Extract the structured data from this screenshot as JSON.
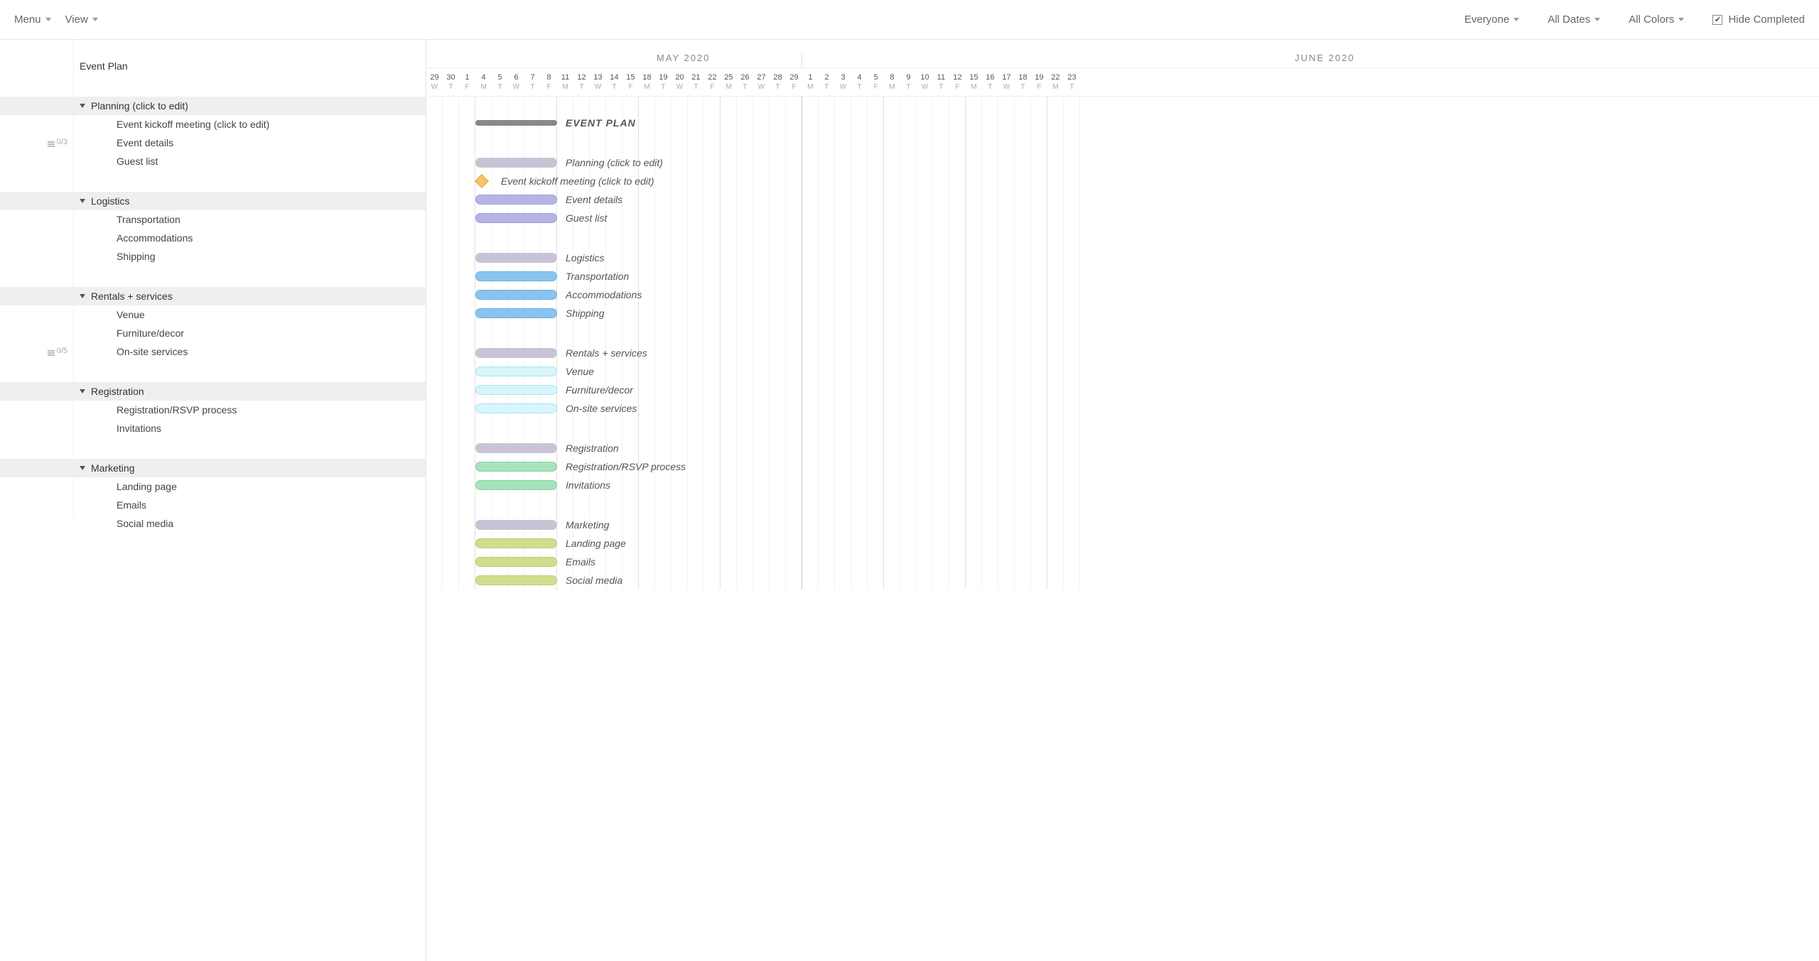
{
  "toolbar": {
    "menu": "Menu",
    "view": "View",
    "filters": {
      "everyone": "Everyone",
      "all_dates": "All Dates",
      "all_colors": "All Colors",
      "hide_completed": "Hide Completed"
    }
  },
  "timeline": {
    "months": [
      {
        "label": "MAY 2020",
        "days": 31,
        "start_index": 2
      },
      {
        "label": "JUNE 2020",
        "days": 30,
        "start_index": 33
      }
    ],
    "first_visible": {
      "day": 29,
      "letter": "W"
    },
    "days": [
      {
        "n": 29,
        "l": "W"
      },
      {
        "n": 30,
        "l": "T"
      },
      {
        "n": 1,
        "l": "F"
      },
      {
        "n": 4,
        "l": "M"
      },
      {
        "n": 5,
        "l": "T"
      },
      {
        "n": 6,
        "l": "W"
      },
      {
        "n": 7,
        "l": "T"
      },
      {
        "n": 8,
        "l": "F"
      },
      {
        "n": 11,
        "l": "M"
      },
      {
        "n": 12,
        "l": "T"
      },
      {
        "n": 13,
        "l": "W"
      },
      {
        "n": 14,
        "l": "T"
      },
      {
        "n": 15,
        "l": "F"
      },
      {
        "n": 18,
        "l": "M"
      },
      {
        "n": 19,
        "l": "T"
      },
      {
        "n": 20,
        "l": "W"
      },
      {
        "n": 21,
        "l": "T"
      },
      {
        "n": 22,
        "l": "F"
      },
      {
        "n": 25,
        "l": "M"
      },
      {
        "n": 26,
        "l": "T"
      },
      {
        "n": 27,
        "l": "W"
      },
      {
        "n": 28,
        "l": "T"
      },
      {
        "n": 29,
        "l": "F"
      },
      {
        "n": 1,
        "l": "M"
      },
      {
        "n": 2,
        "l": "T"
      },
      {
        "n": 3,
        "l": "W"
      },
      {
        "n": 4,
        "l": "T"
      },
      {
        "n": 5,
        "l": "F"
      },
      {
        "n": 8,
        "l": "M"
      },
      {
        "n": 9,
        "l": "T"
      },
      {
        "n": 10,
        "l": "W"
      },
      {
        "n": 11,
        "l": "T"
      },
      {
        "n": 12,
        "l": "F"
      },
      {
        "n": 15,
        "l": "M"
      },
      {
        "n": 16,
        "l": "T"
      },
      {
        "n": 17,
        "l": "W"
      },
      {
        "n": 18,
        "l": "T"
      },
      {
        "n": 19,
        "l": "F"
      },
      {
        "n": 22,
        "l": "M"
      },
      {
        "n": 23,
        "l": "T"
      }
    ]
  },
  "project": {
    "title": "Event Plan",
    "chart_title": "EVENT PLAN"
  },
  "badges": {
    "event_details": "0/3",
    "on_site": "0/5"
  },
  "groups": [
    {
      "name": "Planning (click to edit)",
      "color": "lav",
      "tasks": [
        {
          "name": "Event kickoff meeting (click to edit)",
          "milestone": true
        },
        {
          "name": "Event details",
          "badge": "event_details"
        },
        {
          "name": "Guest list"
        }
      ]
    },
    {
      "name": "Logistics",
      "color": "blue",
      "tasks": [
        {
          "name": "Transportation"
        },
        {
          "name": "Accommodations"
        },
        {
          "name": "Shipping"
        }
      ]
    },
    {
      "name": "Rentals + services",
      "color": "cyan",
      "tasks": [
        {
          "name": "Venue"
        },
        {
          "name": "Furniture/decor"
        },
        {
          "name": "On-site services",
          "badge": "on_site"
        }
      ]
    },
    {
      "name": "Registration",
      "color": "green",
      "tasks": [
        {
          "name": "Registration/RSVP process"
        },
        {
          "name": "Invitations"
        }
      ]
    },
    {
      "name": "Marketing",
      "color": "olive",
      "tasks": [
        {
          "name": "Landing page"
        },
        {
          "name": "Emails"
        },
        {
          "name": "Social media"
        }
      ]
    }
  ],
  "chart_data": {
    "type": "gantt",
    "x_unit": "day",
    "x_start": "2020-04-29",
    "project_bar": {
      "start": "2020-05-01",
      "end": "2020-05-08"
    },
    "group_bars": {
      "start": "2020-05-01",
      "end": "2020-05-08"
    },
    "task_bars": {
      "start": "2020-05-01",
      "end": "2020-05-08"
    },
    "milestone": {
      "date": "2020-05-01"
    }
  }
}
